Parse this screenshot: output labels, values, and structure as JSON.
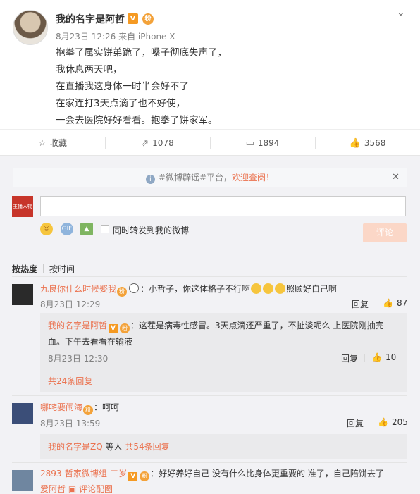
{
  "post": {
    "author": "我的名字是阿哲",
    "verified_badge": "V",
    "medal_badge": "粉",
    "meta": "8月23日 12:26 来自 iPhone X",
    "body_lines": [
      "抱拳了属实饼弟跪了，嗓子彻底失声了，",
      "我休息两天吧，",
      "在直播我这身体一时半会好不了",
      "在家连打3天点滴了也不好使，",
      "一会去医院好好看看。抱拳了饼家军。"
    ]
  },
  "actions": {
    "favorite": "收藏",
    "repost": "1078",
    "comment": "1894",
    "like": "3568"
  },
  "notice": {
    "text": "#微博辟谣#平台，",
    "link": "欢迎查阅！"
  },
  "composer": {
    "avatar_text": "主播人物",
    "emoji_icon": "☺",
    "gif_icon": "GIF",
    "image_icon": "▲",
    "repost_label": "同时转发到我的微博",
    "submit": "评论"
  },
  "sort": {
    "hot": "按热度",
    "time": "按时间"
  },
  "comments": [
    {
      "user": "九良你什么时候娶我",
      "text_a": "：小哲子，你这体格子不行啊",
      "text_b": "照顾好自己啊",
      "time": "8月23日 12:29",
      "reply": "回复",
      "likes": "87",
      "sub": {
        "user": "我的名字是阿哲",
        "line1": "：这茬是病毒性感冒。3天点滴还严重了，不扯淡呢么 上医院刚抽完",
        "line2": "血。下午去看看在输液",
        "time": "8月23日 12:30",
        "reply": "回复",
        "likes": "10",
        "more": "共24条回复"
      }
    },
    {
      "user": "哪咤要闹海",
      "text_a": "：呵呵",
      "time": "8月23日 13:59",
      "reply": "回复",
      "likes": "205",
      "sub": {
        "user": "我的名字是ZQ",
        "others": " 等人 ",
        "more": "共54条回复"
      }
    },
    {
      "user": "2893-哲家微博组-二岁",
      "text_a": "：好好养好自己 没有什么比身体更重要的 准了，自己陪饼去了",
      "line2_user": "爱阿哲",
      "line2_extra": "评论配图"
    }
  ]
}
